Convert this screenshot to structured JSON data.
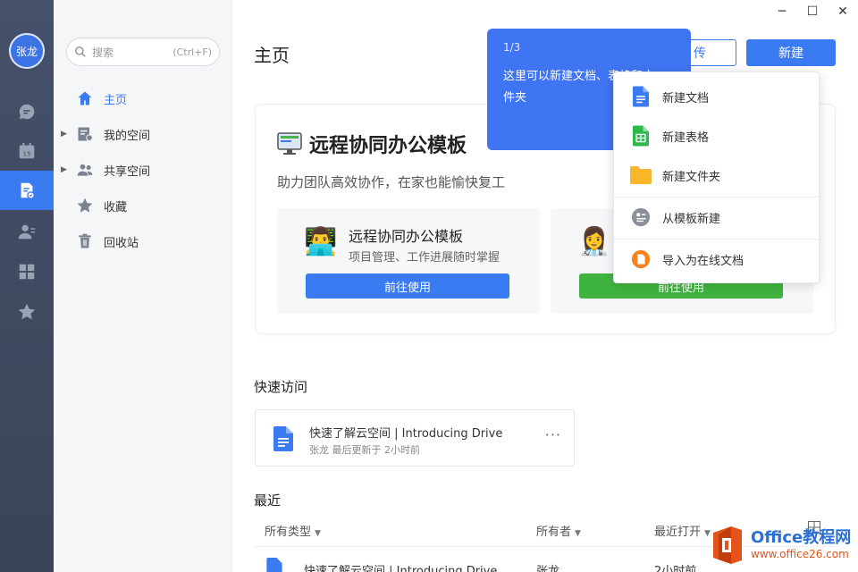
{
  "user": {
    "avatar_text": "张龙"
  },
  "rail": {
    "icons": [
      "chat-icon",
      "calendar-icon",
      "cloud-docs-icon",
      "contacts-icon",
      "apps-icon",
      "star-icon"
    ],
    "calendar_day": "15"
  },
  "sidebar": {
    "search_placeholder": "搜索",
    "search_shortcut": "(Ctrl+F)",
    "items": [
      {
        "label": "主页",
        "icon": "home-icon"
      },
      {
        "label": "我的空间",
        "icon": "my-space-icon"
      },
      {
        "label": "共享空间",
        "icon": "shared-space-icon"
      },
      {
        "label": "收藏",
        "icon": "star-icon"
      },
      {
        "label": "回收站",
        "icon": "trash-icon"
      }
    ]
  },
  "window": {
    "minimize": "─",
    "maximize": "☐",
    "close": "✕"
  },
  "header": {
    "title": "主页",
    "upload_label": "传",
    "new_label": "新建"
  },
  "banner": {
    "title": "远程协同办公模板",
    "subtitle": "助力团队高效协作，在家也能愉快复工",
    "cards": [
      {
        "emoji": "👨‍💻",
        "name": "远程协同办公模板",
        "desc": "项目管理、工作进展随时掌握",
        "button": "前往使用",
        "color": "#3b7bf2"
      },
      {
        "emoji": "👩‍⚕️",
        "name": "",
        "desc": "",
        "button": "前往使用",
        "color": "#3fb33f"
      }
    ]
  },
  "quick_access": {
    "title": "快速访问",
    "card": {
      "name": "快速了解云空间 | Introducing Drive",
      "meta": "张龙 最后更新于 2小时前",
      "more": "···"
    }
  },
  "recent": {
    "title": "最近",
    "columns": [
      {
        "label": "所有类型",
        "caret": "▼"
      },
      {
        "label": "所有者",
        "caret": "▼"
      },
      {
        "label": "最近打开",
        "caret": "▼"
      }
    ],
    "peek_row": {
      "name": "快速了解云空间 | Introducing Drive",
      "owner": "张龙",
      "time": "2小时前"
    }
  },
  "guide": {
    "step": "1/3",
    "message": "这里可以新建文档、表格和文件夹"
  },
  "new_menu": {
    "items": [
      {
        "label": "新建文档",
        "icon": "doc-icon",
        "color": "#3b7bf2"
      },
      {
        "label": "新建表格",
        "icon": "sheet-icon",
        "color": "#2db84d"
      },
      {
        "label": "新建文件夹",
        "icon": "folder-icon",
        "color": "#f8b62b"
      },
      {
        "label": "从模板新建",
        "icon": "template-icon",
        "color": "#8a8f99"
      },
      {
        "label": "导入为在线文档",
        "icon": "import-icon",
        "color": "#f5821f"
      }
    ]
  },
  "watermark": {
    "line1": "Office教程网",
    "line2": "www.office26.com"
  },
  "colors": {
    "accent": "#3b7bf2",
    "rail": "#45506a",
    "green": "#3fb33f"
  }
}
